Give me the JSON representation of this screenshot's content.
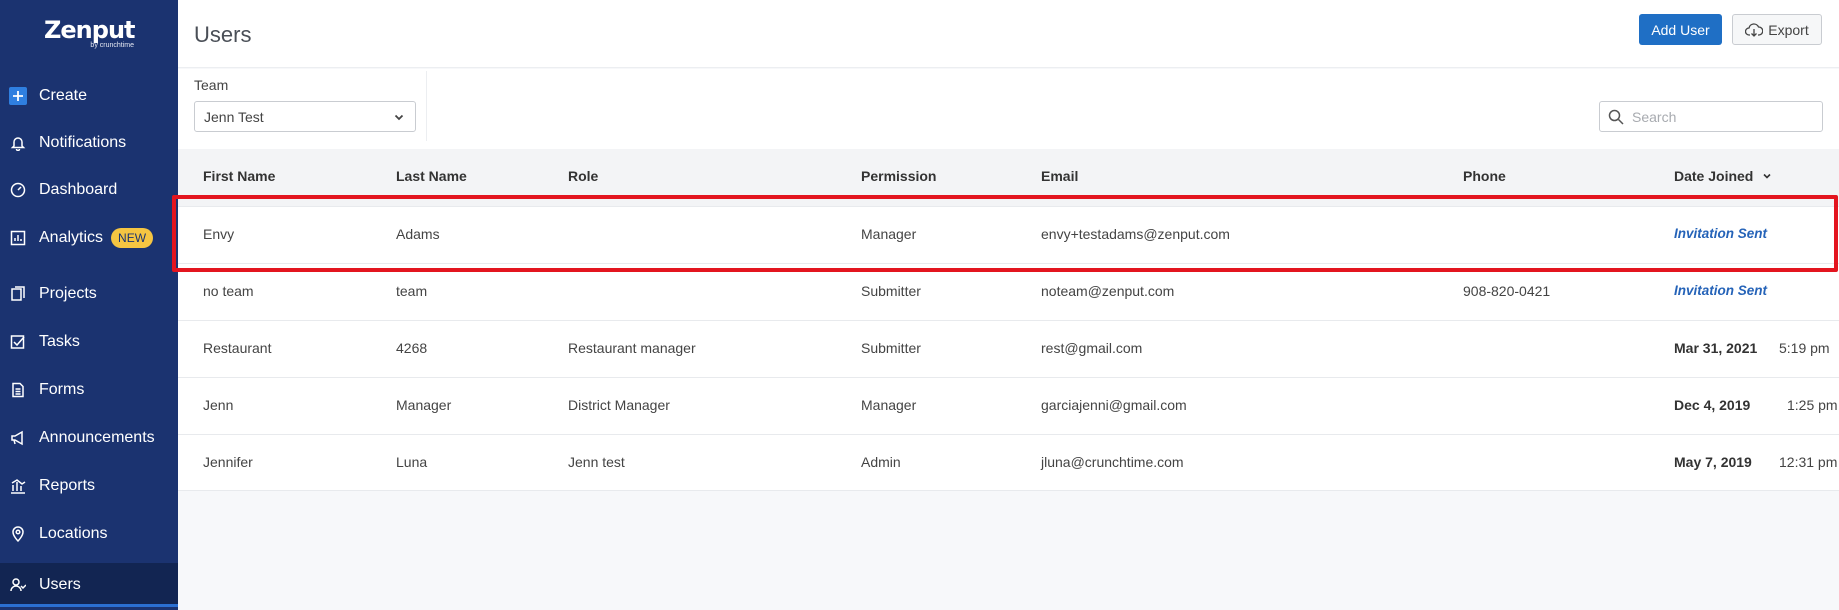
{
  "sidebar": {
    "logo": {
      "brand": "Zenput",
      "sub": "by crunchtime"
    },
    "items": [
      {
        "label": "Create",
        "icon": "plus-icon"
      },
      {
        "label": "Notifications",
        "icon": "bell-icon"
      },
      {
        "label": "Dashboard",
        "icon": "dashboard-icon"
      },
      {
        "label": "Analytics",
        "icon": "analytics-icon",
        "badge": "NEW"
      },
      {
        "label": "Projects",
        "icon": "projects-icon"
      },
      {
        "label": "Tasks",
        "icon": "tasks-icon"
      },
      {
        "label": "Forms",
        "icon": "forms-icon"
      },
      {
        "label": "Announcements",
        "icon": "megaphone-icon"
      },
      {
        "label": "Reports",
        "icon": "reports-icon"
      },
      {
        "label": "Locations",
        "icon": "location-pin-icon"
      },
      {
        "label": "Users",
        "icon": "users-icon",
        "active": true
      }
    ]
  },
  "header": {
    "title": "Users",
    "add_user_label": "Add User",
    "export_label": "Export"
  },
  "filters": {
    "team_label": "Team",
    "team_value": "Jenn Test",
    "search_placeholder": "Search"
  },
  "table": {
    "columns": [
      "First Name",
      "Last Name",
      "Role",
      "Permission",
      "Email",
      "Phone",
      "Date Joined"
    ],
    "rows": [
      {
        "first": "Envy",
        "last": "Adams",
        "role": "",
        "permission": "Manager",
        "email": "envy+testadams@zenput.com",
        "phone": "",
        "date": "Invitation Sent",
        "time": ""
      },
      {
        "first": "no team",
        "last": "team",
        "role": "",
        "permission": "Submitter",
        "email": "noteam@zenput.com",
        "phone": "908-820-0421",
        "date": "Invitation Sent",
        "time": ""
      },
      {
        "first": "Restaurant",
        "last": "4268",
        "role": "Restaurant manager",
        "permission": "Submitter",
        "email": "rest@gmail.com",
        "phone": "",
        "date": "Mar 31, 2021",
        "time": "5:19 pm"
      },
      {
        "first": "Jenn",
        "last": "Manager",
        "role": "District Manager",
        "permission": "Manager",
        "email": "garciajenni@gmail.com",
        "phone": "",
        "date": "Dec 4, 2019",
        "time": "1:25 pm"
      },
      {
        "first": "Jennifer",
        "last": "Luna",
        "role": "Jenn test",
        "permission": "Admin",
        "email": "jluna@crunchtime.com",
        "phone": "",
        "date": "May 7, 2019",
        "time": "12:31 pm"
      }
    ]
  }
}
